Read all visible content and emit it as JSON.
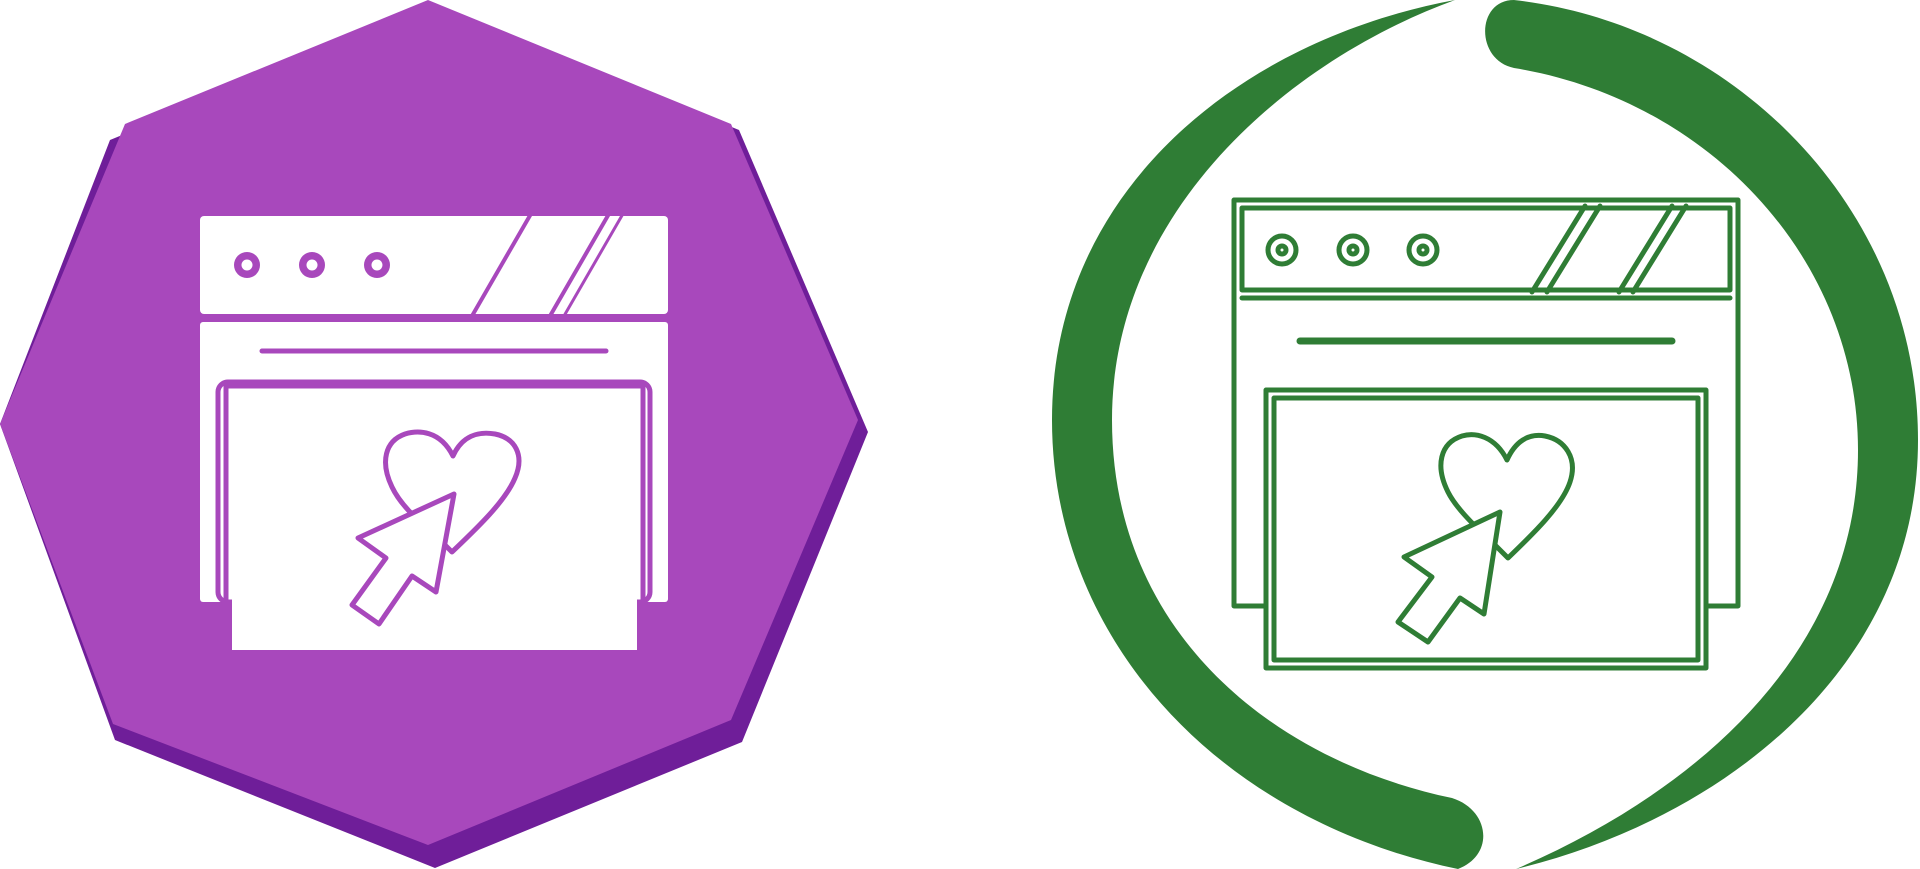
{
  "icons": [
    {
      "name": "favorite-webpage-glyph-icon",
      "style": "glyph",
      "badge_shape": "octagon",
      "badge_color": "#a848bc",
      "badge_shadow_color": "#6f1e99",
      "foreground_color": "#ffffff",
      "depicts": [
        "browser-window-icon",
        "heart-icon",
        "cursor-arrow-icon"
      ]
    },
    {
      "name": "favorite-webpage-line-icon",
      "style": "line",
      "badge_shape": "circular-arrows",
      "stroke_color": "#2f7d35",
      "depicts": [
        "browser-window-icon",
        "heart-icon",
        "cursor-arrow-icon"
      ]
    }
  ]
}
